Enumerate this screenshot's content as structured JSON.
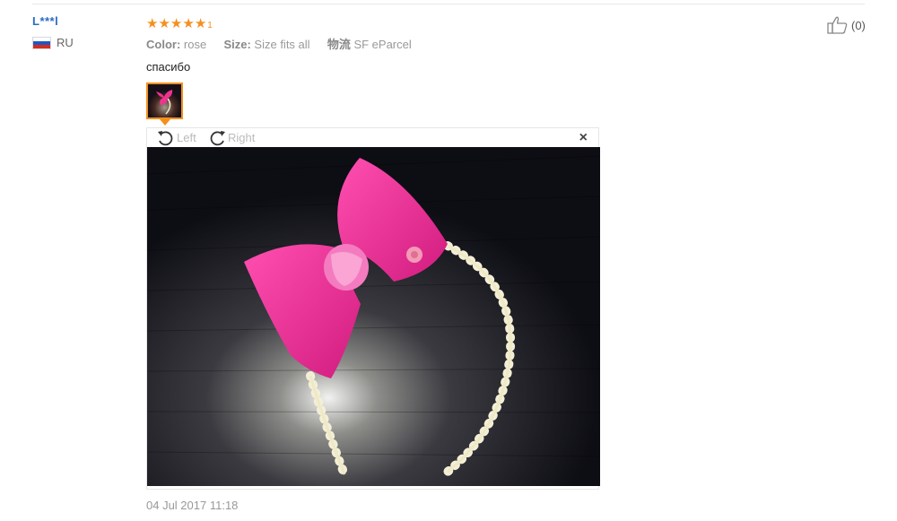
{
  "user": {
    "name": "L***l",
    "country_code": "RU",
    "flag_colors": [
      "#ffffff",
      "#1f56c4",
      "#d52b1e"
    ]
  },
  "review": {
    "rating": 5,
    "rating_suffix": "1",
    "meta": {
      "color_label": "Color:",
      "color_value": "rose",
      "size_label": "Size:",
      "size_value": "Size fits all",
      "shipping_label": "物流",
      "shipping_value": "SF eParcel"
    },
    "text": "спасибо",
    "date": "04 Jul 2017 11:18"
  },
  "viewer": {
    "rotate_left_label": "Left",
    "rotate_right_label": "Right",
    "close_symbol": "×"
  },
  "helpful": {
    "count_label": "(0)"
  },
  "colors": {
    "accent": "#f5901e",
    "link": "#2b6cc4",
    "bow": "#f0328f"
  },
  "icons": [
    "rotate-left-icon",
    "rotate-right-icon",
    "close-icon",
    "thumbs-up-icon",
    "star-icon"
  ]
}
